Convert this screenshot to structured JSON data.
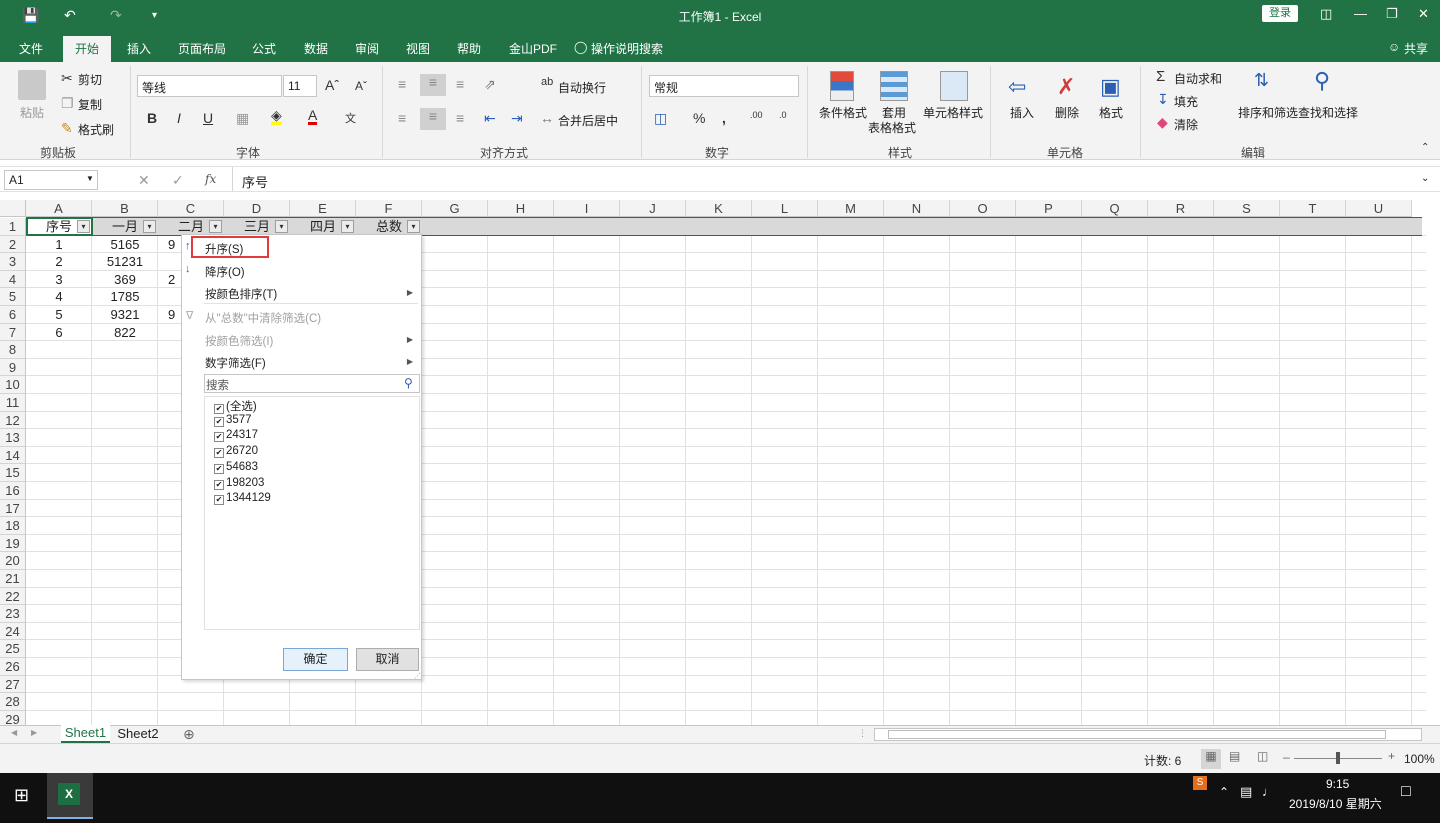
{
  "window": {
    "title": "工作簿1 - Excel",
    "login": "登录"
  },
  "tabs": [
    "文件",
    "开始",
    "插入",
    "页面布局",
    "公式",
    "数据",
    "审阅",
    "视图",
    "帮助",
    "金山PDF",
    "操作说明搜索"
  ],
  "share": "共享",
  "ribbon": {
    "clipboard": {
      "paste": "粘贴",
      "cut": "剪切",
      "copy": "复制",
      "format_painter": "格式刷",
      "label": "剪贴板"
    },
    "font": {
      "name": "等线",
      "size": "11",
      "label": "字体"
    },
    "align": {
      "wrap": "自动换行",
      "merge": "合并后居中",
      "label": "对齐方式"
    },
    "number": {
      "format": "常规",
      "label": "数字"
    },
    "styles": {
      "conditional": "条件格式",
      "table_format_1": "套用",
      "table_format_2": "表格格式",
      "cell_styles": "单元格样式",
      "label": "样式"
    },
    "cells": {
      "insert": "插入",
      "delete": "删除",
      "format": "格式",
      "label": "单元格"
    },
    "editing": {
      "autosum": "自动求和",
      "fill": "填充",
      "clear": "清除",
      "sort_filter": "排序和筛选",
      "find_select": "查找和选择",
      "label": "编辑"
    }
  },
  "formula_bar": {
    "name_box": "A1",
    "content": "序号"
  },
  "columns": [
    "A",
    "B",
    "C",
    "D",
    "E",
    "F",
    "G",
    "H",
    "I",
    "J",
    "K",
    "L",
    "M",
    "N",
    "O",
    "P",
    "Q",
    "R",
    "S",
    "T",
    "U"
  ],
  "rows": [
    "1",
    "2",
    "3",
    "4",
    "5",
    "6",
    "7",
    "8",
    "9",
    "10",
    "11",
    "12",
    "13",
    "14",
    "15",
    "16",
    "17",
    "18",
    "19",
    "20",
    "21",
    "22",
    "23",
    "24",
    "25",
    "26",
    "27",
    "28",
    "29"
  ],
  "table": {
    "headers": [
      "序号",
      "一月",
      "二月",
      "三月",
      "四月",
      "总数"
    ],
    "col_a": [
      "1",
      "2",
      "3",
      "4",
      "5",
      "6"
    ],
    "col_b": [
      "5165",
      "51231",
      "369",
      "1785",
      "9321",
      "822"
    ],
    "col_c_partial": [
      "9",
      "",
      "2",
      "",
      "9",
      ""
    ]
  },
  "filter_menu": {
    "sort_asc": "升序(S)",
    "sort_desc": "降序(O)",
    "sort_by_color": "按颜色排序(T)",
    "clear_filter": "从\"总数\"中清除筛选(C)",
    "filter_by_color": "按颜色筛选(I)",
    "number_filters": "数字筛选(F)",
    "search_placeholder": "搜索",
    "items": [
      "(全选)",
      "3577",
      "24317",
      "26720",
      "54683",
      "198203",
      "1344129"
    ],
    "ok": "确定",
    "cancel": "取消"
  },
  "sheets": [
    "Sheet1",
    "Sheet2"
  ],
  "status": {
    "count": "计数: 6",
    "zoom": "100%"
  },
  "taskbar": {
    "time": "9:15",
    "date": "2019/8/10 星期六"
  }
}
